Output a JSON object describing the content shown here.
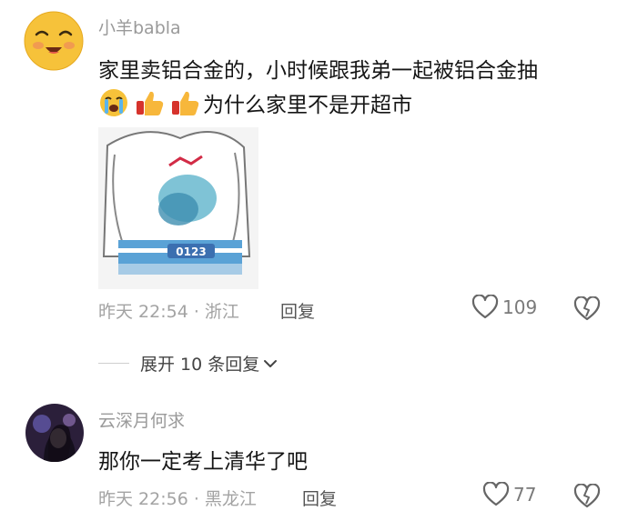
{
  "comments": [
    {
      "username": "小羊babla",
      "text_line1": "家里卖铝合金的，小时候跟我弟一起被铝合金抽",
      "text_line2": "为什么家里不是开超市",
      "emojis": [
        "crying-face-icon",
        "thumbs-up-icon",
        "thumbs-up-icon"
      ],
      "timestamp": "昨天 22:54 · 浙江",
      "reply_label": "回复",
      "likes": "109",
      "sticker_caption": "0123"
    },
    {
      "username": "云深月何求",
      "text": "那你一定考上清华了吧",
      "timestamp": "昨天 22:56 · 黑龙江",
      "reply_label": "回复",
      "likes": "77"
    }
  ],
  "expand_replies_label": "展开 10 条回复",
  "colors": {
    "avatar_yellow": "#f7c640",
    "accent_blue": "#5aa2d6",
    "muted": "#9a9a9a"
  }
}
